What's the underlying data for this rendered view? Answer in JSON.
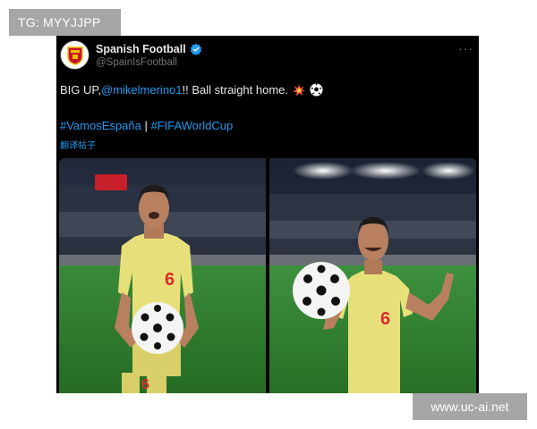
{
  "watermarks": {
    "top": "TG: MYYJJPP",
    "bottom": "www.uc-ai.net"
  },
  "tweet": {
    "display_name": "Spanish Football",
    "handle": "@SpainIsFootball",
    "text_start": "BIG UP, ",
    "mention": "@mikelmerino1",
    "text_end": "!! Ball straight home.",
    "hashtag1": "#VamosEspaña",
    "separator": " | ",
    "hashtag2": "#FIFAWorldCup",
    "translate": "翻译帖子",
    "more": "···"
  },
  "photos": [
    {
      "jersey_number": "6"
    },
    {
      "jersey_number": "6"
    }
  ],
  "colors": {
    "accent": "#1d9bf0",
    "jersey": "#e7e07a",
    "pitch": "#2f7f2f"
  }
}
